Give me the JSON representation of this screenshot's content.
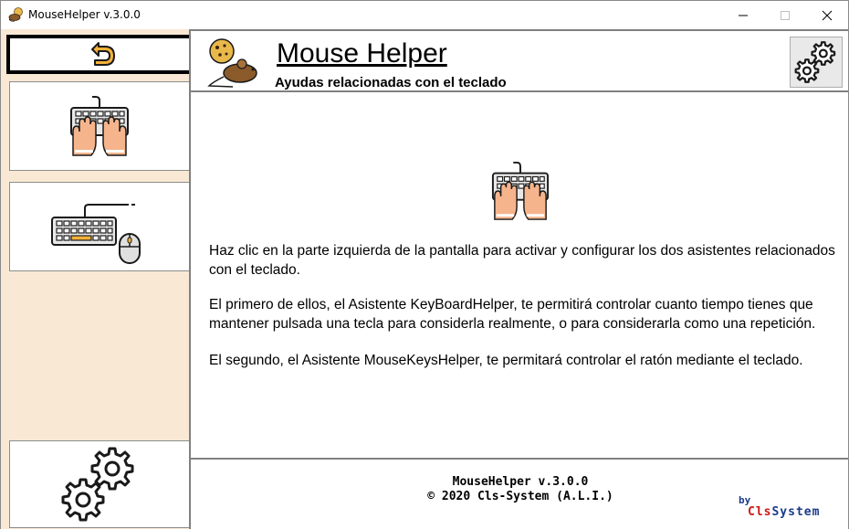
{
  "window": {
    "title": "MouseHelper v.3.0.0",
    "controls": {
      "minimize": "minimize",
      "maximize": "maximize",
      "close": "close"
    }
  },
  "sidebar": {
    "items": [
      {
        "name": "back",
        "icon": "undo-arrow-icon"
      },
      {
        "name": "keyboard-helper",
        "icon": "keyboard-hands-icon"
      },
      {
        "name": "mouse-keys-helper",
        "icon": "keyboard-mouse-icon"
      },
      {
        "name": "settings",
        "icon": "gears-icon"
      }
    ]
  },
  "header": {
    "title": "Mouse Helper",
    "subtitle": "Ayudas relacionadas con el teclado",
    "logo_icon": "mouse-cookie-icon",
    "config_icon": "gears-icon"
  },
  "content": {
    "icon": "keyboard-hands-icon",
    "paragraph1": "Haz clic en la parte izquierda de la pantalla para activar y configurar los dos asistentes relacionados con el teclado.",
    "paragraph2": "El primero de ellos, el Asistente KeyBoardHelper, te permitirá controlar cuanto tiempo tienes que mantener pulsada una tecla para considerla realmente, o para considerarla como una repetición.",
    "paragraph3": "El segundo, el Asistente MouseKeysHelper, te permitará controlar el ratón mediante el teclado."
  },
  "footer": {
    "version": "MouseHelper v.3.0.0",
    "copyright": "©  2020 Cls-System (A.L.I.)",
    "by": "by",
    "brand_part1": "Cls",
    "brand_part2": "System"
  },
  "colors": {
    "sidebar_bg": "#f9e9d4",
    "accent_orange": "#f3b13a",
    "skin": "#f6b48c",
    "brand_red": "#d01515",
    "brand_blue": "#1a3a8a"
  }
}
